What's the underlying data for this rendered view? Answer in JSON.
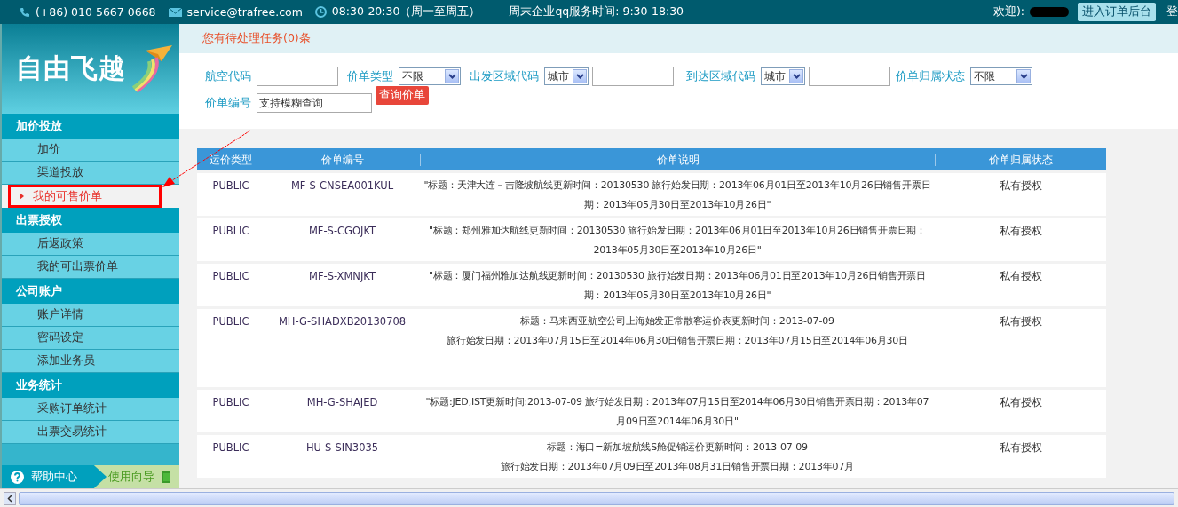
{
  "top_bar": {
    "phone": "(+86) 010 5667 0668",
    "email": "service@trafree.com",
    "hours": "08:30-20:30（周一至周五）",
    "weekend": "周末企业qq服务时间: 9:30-18:30",
    "welcome": "欢迎):",
    "backend_button": "进入订单后台",
    "logout": "登"
  },
  "logo": {
    "text": "自由飞越"
  },
  "sidebar": {
    "sections": [
      {
        "title": "加价投放",
        "items": [
          {
            "label": "加价",
            "selected": false
          },
          {
            "label": "渠道投放",
            "selected": false
          },
          {
            "label": "我的可售价单",
            "selected": true
          }
        ]
      },
      {
        "title": "出票授权",
        "items": [
          {
            "label": "后返政策",
            "selected": false
          },
          {
            "label": "我的可出票价单",
            "selected": false
          }
        ]
      },
      {
        "title": "公司账户",
        "items": [
          {
            "label": "账户详情",
            "selected": false
          },
          {
            "label": "密码设定",
            "selected": false
          },
          {
            "label": "添加业务员",
            "selected": false
          }
        ]
      },
      {
        "title": "业务统计",
        "items": [
          {
            "label": "采购订单统计",
            "selected": false
          },
          {
            "label": "出票交易统计",
            "selected": false
          }
        ]
      }
    ],
    "help": "帮助中心",
    "guide": "使用向导"
  },
  "notice": "您有待处理任务(0)条",
  "filters": [
    {
      "label": "航空代码",
      "controls": [
        {
          "kind": "input"
        }
      ]
    },
    {
      "label": "价单类型",
      "controls": [
        {
          "kind": "select",
          "value": "不限"
        }
      ]
    },
    {
      "label": "出发区域代码",
      "controls": [
        {
          "kind": "select",
          "value": "城市"
        },
        {
          "kind": "input"
        }
      ]
    },
    {
      "label": "到达区域代码",
      "controls": [
        {
          "kind": "select",
          "value": "城市"
        },
        {
          "kind": "input"
        }
      ]
    },
    {
      "label": "价单归属状态",
      "controls": [
        {
          "kind": "select",
          "value": "不限"
        }
      ]
    },
    {
      "label": "价单编号",
      "controls": [
        {
          "kind": "input",
          "value": "支持模糊查询"
        }
      ]
    }
  ],
  "search_button": "查询价单",
  "table": {
    "columns": [
      "运价类型",
      "价单编号",
      "价单说明",
      "价单归属状态"
    ],
    "rows": [
      {
        "type": "PUBLIC",
        "code": "MF-S-CNSEA001KUL",
        "description": [
          "\"标题：天津大连－吉隆坡航线更新时间：20130530 旅行始发日期：2013年06月01日至2013年10月26日销售开票日期：2013年05月30日至2013年10月26日\""
        ],
        "status": "私有授权"
      },
      {
        "type": "PUBLIC",
        "code": "MF-S-CGOJKT",
        "description": [
          "\"标题：郑州雅加达航线更新时间：20130530 旅行始发日期：2013年06月01日至2013年10月26日销售开票日期：2013年05月30日至2013年10月26日\""
        ],
        "status": "私有授权"
      },
      {
        "type": "PUBLIC",
        "code": "MF-S-XMNJKT",
        "description": [
          "\"标题：厦门福州雅加达航线更新时间：20130530 旅行始发日期：2013年06月01日至2013年10月26日销售开票日期：2013年05月30日至2013年10月26日\""
        ],
        "status": "私有授权"
      },
      {
        "type": "PUBLIC",
        "code": "MH-G-SHADXB20130708",
        "description": [
          "标题：马来西亚航空公司上海始发正常散客运价表更新时间：2013-07-09",
          "旅行始发日期：2013年07月15日至2014年06月30日销售开票日期：2013年07月15日至2014年06月30日"
        ],
        "status": "私有授权"
      },
      {
        "type": "PUBLIC",
        "code": "MH-G-SHAJED",
        "description": [
          "\"标题:JED,IST更新时间:2013-07-09 旅行始发日期：2013年07月15日至2014年06月30日销售开票日期：2013年07月09日至2014年06月30日\""
        ],
        "status": "私有授权"
      },
      {
        "type": "PUBLIC",
        "code": "HU-S-SIN3035",
        "description": [
          "标题：海口=新加坡航线S舱促销运价更新时间：2013-07-09",
          "旅行始发日期：2013年07月09日至2013年08月31日销售开票日期：2013年07月"
        ],
        "status": "私有授权"
      }
    ]
  }
}
